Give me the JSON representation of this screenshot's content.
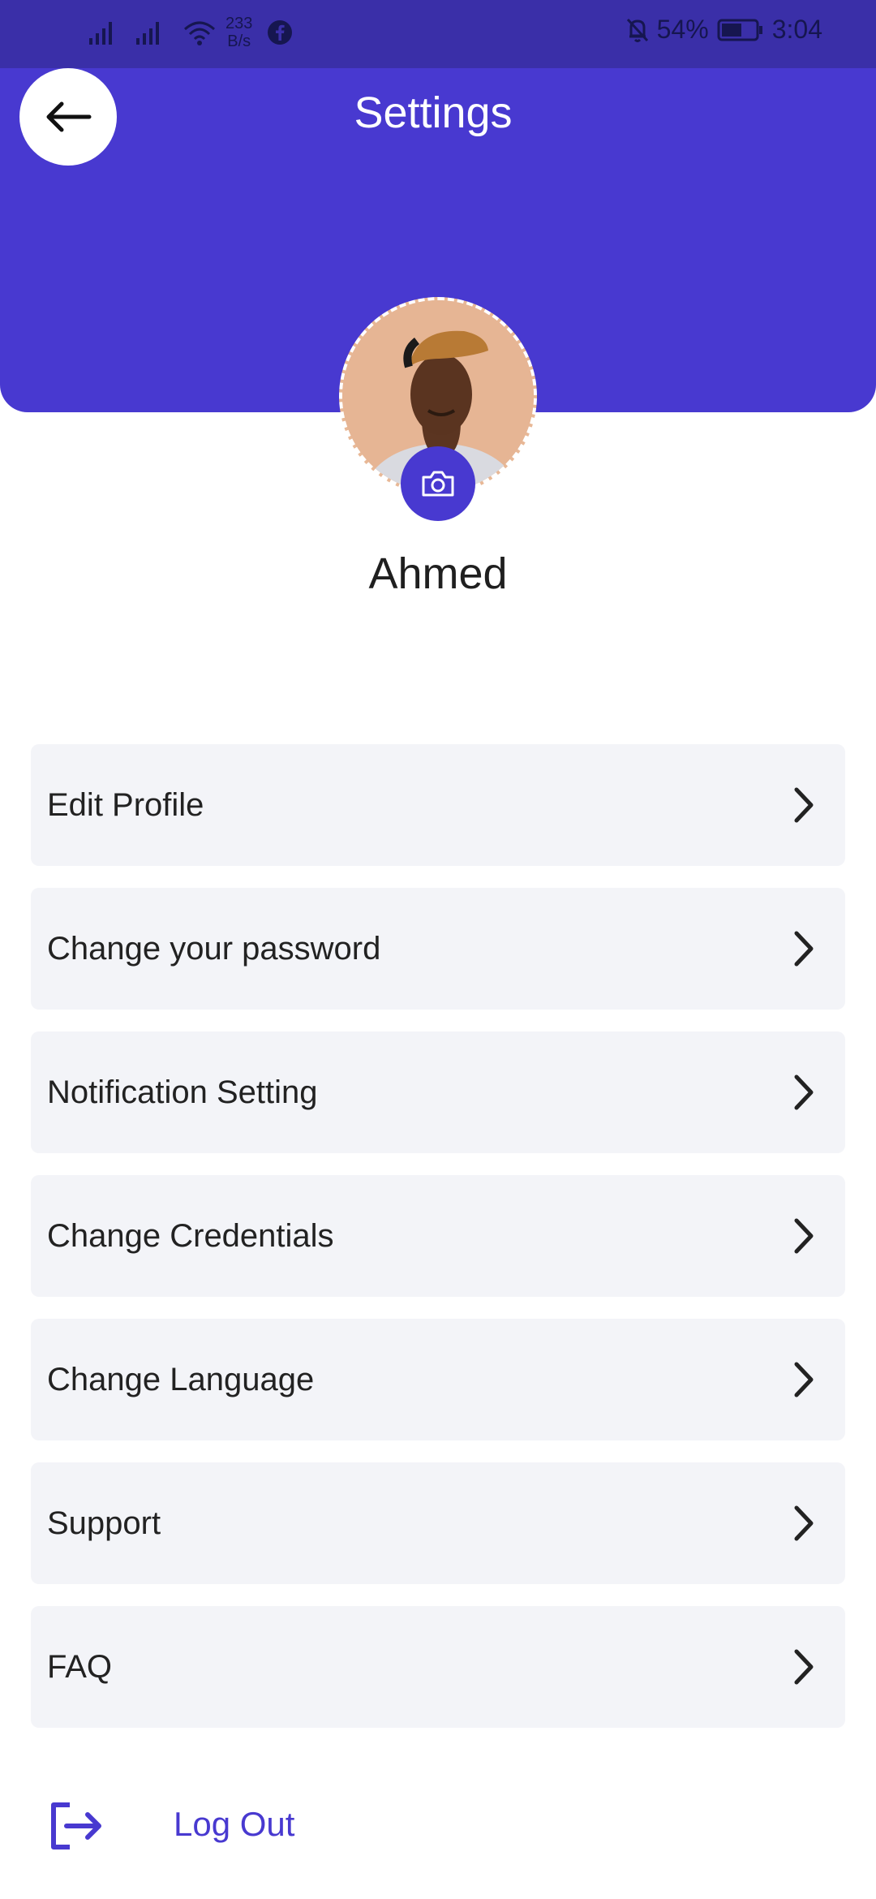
{
  "status_bar": {
    "net_speed_value": "233",
    "net_speed_unit": "B/s",
    "battery": "54%",
    "time": "3:04",
    "icons": [
      "signal-icon",
      "signal-icon",
      "wifi-icon",
      "facebook-icon",
      "bell-off-icon",
      "battery-icon"
    ]
  },
  "header": {
    "title": "Settings",
    "back_icon": "arrow-left-icon",
    "color": "#4839d0"
  },
  "profile": {
    "name": "Ahmed",
    "camera_icon": "camera-icon"
  },
  "menu": {
    "items": [
      {
        "label": "Edit Profile"
      },
      {
        "label": "Change your password"
      },
      {
        "label": "Notification Setting"
      },
      {
        "label": "Change Credentials"
      },
      {
        "label": "Change Language"
      },
      {
        "label": "Support"
      },
      {
        "label": "FAQ"
      }
    ],
    "chevron_icon": "chevron-right-icon"
  },
  "logout": {
    "label": "Log Out",
    "icon": "logout-icon"
  }
}
